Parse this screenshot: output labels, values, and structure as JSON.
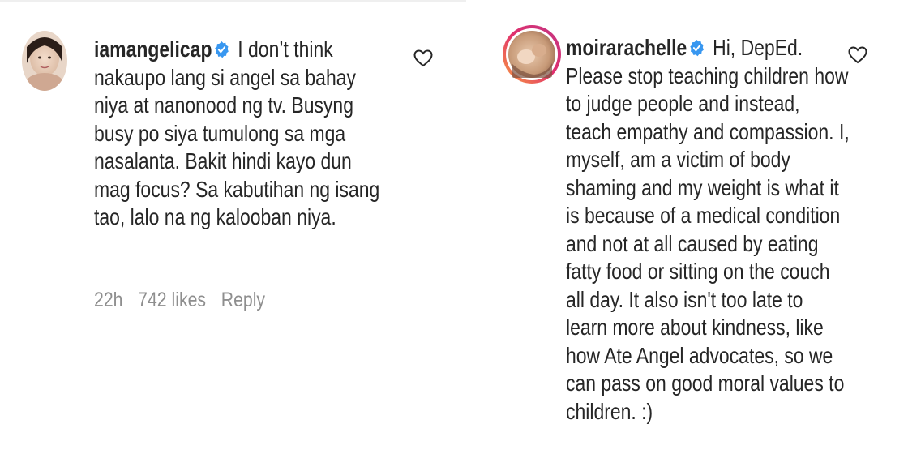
{
  "comments": [
    {
      "username": "iamangelicap",
      "verified": true,
      "lines": [
        " I don’t think",
        "nakaupo lang si angel sa bahay",
        "niya at nanonood ng tv. Busyng",
        "busy po siya tumulong sa mga",
        "nasalanta. Bakit hindi kayo dun",
        "mag focus? Sa kabutihan ng isang",
        "tao, lalo na ng kalooban niya."
      ],
      "time": "22h",
      "likes": "742 likes",
      "reply_label": "Reply",
      "heart_icon": "heart-outline-icon"
    },
    {
      "username": "moirarachelle",
      "verified": true,
      "lines": [
        " Hi, DepEd.",
        "Please stop teaching children how",
        "to judge people and instead,",
        "teach empathy and compassion. I,",
        "myself, am a victim of body",
        "shaming and my weight is what it",
        "is because of a medical condition",
        "and not at all caused by eating",
        "fatty food or sitting on the couch",
        "all day. It also isn't too late to",
        "learn more about kindness, like",
        "how Ate Angel advocates, so we",
        "can pass on good moral values to",
        "children. :)"
      ],
      "heart_icon": "heart-outline-icon",
      "story_ring_colors": [
        "#f9a03f",
        "#e1306c",
        "#c13584"
      ]
    }
  ],
  "colors": {
    "text": "#262626",
    "muted": "#8e8e8e",
    "verified_blue": "#3897f0"
  }
}
